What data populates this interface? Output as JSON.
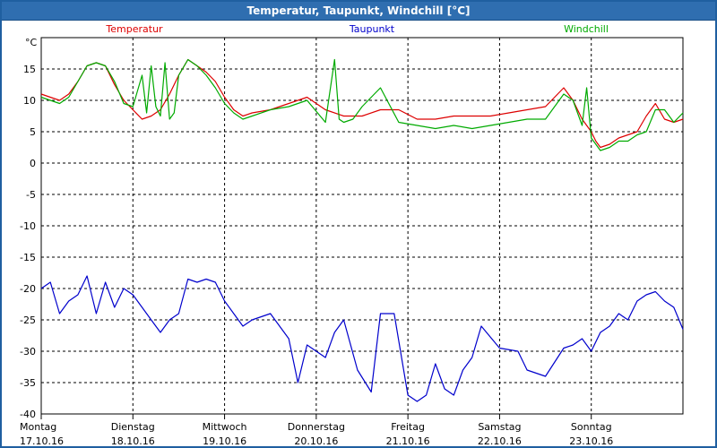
{
  "window": {
    "title": "Temperatur, Taupunkt, Windchill [°C]"
  },
  "chart_data": {
    "type": "line",
    "title": "Temperatur, Taupunkt, Windchill [°C]",
    "ylabel": "°C",
    "ylim": [
      -40,
      20
    ],
    "y_ticks": [
      15,
      10,
      5,
      0,
      -5,
      -10,
      -15,
      -20,
      -25,
      -30,
      -35,
      -40
    ],
    "xlim": [
      0,
      7
    ],
    "x_ticks": [
      {
        "day": "Montag",
        "date": "17.10.16"
      },
      {
        "day": "Dienstag",
        "date": "18.10.16"
      },
      {
        "day": "Mittwoch",
        "date": "19.10.16"
      },
      {
        "day": "Donnerstag",
        "date": "20.10.16"
      },
      {
        "day": "Freitag",
        "date": "21.10.16"
      },
      {
        "day": "Samstag",
        "date": "22.10.16"
      },
      {
        "day": "Sonntag",
        "date": "23.10.16"
      }
    ],
    "grid": true,
    "legend": "top",
    "series": [
      {
        "name": "Temperatur",
        "color": "#dd0000",
        "x": [
          0,
          0.1,
          0.2,
          0.3,
          0.4,
          0.5,
          0.6,
          0.7,
          0.8,
          0.9,
          1.0,
          1.1,
          1.2,
          1.3,
          1.4,
          1.5,
          1.6,
          1.7,
          1.8,
          1.9,
          2.0,
          2.1,
          2.2,
          2.3,
          2.5,
          2.7,
          2.9,
          3.1,
          3.3,
          3.5,
          3.7,
          3.9,
          4.1,
          4.3,
          4.5,
          4.7,
          4.9,
          5.1,
          5.3,
          5.5,
          5.7,
          5.8,
          5.9,
          6.0,
          6.05,
          6.1,
          6.2,
          6.3,
          6.4,
          6.5,
          6.6,
          6.7,
          6.8,
          6.9,
          7.0
        ],
        "values": [
          11,
          10.5,
          10,
          11,
          13,
          15.5,
          16,
          15.5,
          12.5,
          10,
          8.5,
          7,
          7.5,
          8.5,
          11,
          14,
          16.5,
          15.5,
          14.5,
          13,
          10.5,
          8.5,
          7.5,
          8,
          8.5,
          9.5,
          10.5,
          8.5,
          7.5,
          7.5,
          8.5,
          8.5,
          7,
          7,
          7.5,
          7.5,
          7.5,
          8,
          8.5,
          9,
          12,
          10,
          7,
          5,
          3.5,
          2.5,
          3,
          4,
          4.5,
          5,
          7.5,
          9.5,
          7,
          6.5,
          7
        ]
      },
      {
        "name": "Taupunkt",
        "color": "#0000cc",
        "x": [
          0,
          0.1,
          0.2,
          0.3,
          0.4,
          0.5,
          0.6,
          0.7,
          0.8,
          0.9,
          1.0,
          1.1,
          1.2,
          1.3,
          1.4,
          1.5,
          1.6,
          1.7,
          1.8,
          1.9,
          2.0,
          2.1,
          2.2,
          2.3,
          2.5,
          2.7,
          2.8,
          2.9,
          3.1,
          3.2,
          3.3,
          3.45,
          3.6,
          3.7,
          3.85,
          4.0,
          4.1,
          4.2,
          4.3,
          4.4,
          4.5,
          4.6,
          4.7,
          4.8,
          5.0,
          5.2,
          5.3,
          5.5,
          5.7,
          5.8,
          5.9,
          6.0,
          6.1,
          6.2,
          6.3,
          6.4,
          6.5,
          6.6,
          6.7,
          6.8,
          6.9,
          7.0
        ],
        "values": [
          -20,
          -19,
          -24,
          -22,
          -21,
          -18,
          -24,
          -19,
          -23,
          -20,
          -21,
          -23,
          -25,
          -27,
          -25,
          -24,
          -18.5,
          -19,
          -18.5,
          -19,
          -22,
          -24,
          -26,
          -25,
          -24,
          -28,
          -35,
          -29,
          -31,
          -27,
          -25,
          -33,
          -36.5,
          -24,
          -24,
          -37,
          -38,
          -37,
          -32,
          -36,
          -37,
          -33,
          -31,
          -26,
          -29.5,
          -30,
          -33,
          -34,
          -29.5,
          -29,
          -28,
          -30,
          -27,
          -26,
          -24,
          -25,
          -22,
          -21,
          -20.5,
          -22,
          -23,
          -26.5
        ]
      },
      {
        "name": "Windchill",
        "color": "#00aa00",
        "x": [
          0,
          0.1,
          0.2,
          0.3,
          0.4,
          0.5,
          0.6,
          0.7,
          0.8,
          0.9,
          1.0,
          1.1,
          1.15,
          1.2,
          1.25,
          1.3,
          1.35,
          1.4,
          1.45,
          1.5,
          1.6,
          1.7,
          1.8,
          1.9,
          2.0,
          2.1,
          2.2,
          2.3,
          2.5,
          2.7,
          2.9,
          3.1,
          3.2,
          3.25,
          3.3,
          3.4,
          3.5,
          3.7,
          3.9,
          4.1,
          4.3,
          4.5,
          4.7,
          4.9,
          5.1,
          5.3,
          5.5,
          5.7,
          5.8,
          5.9,
          5.95,
          6.0,
          6.1,
          6.2,
          6.3,
          6.4,
          6.5,
          6.6,
          6.7,
          6.8,
          6.9,
          7.0
        ],
        "values": [
          10.5,
          10,
          9.5,
          10.5,
          13,
          15.5,
          16,
          15.5,
          13,
          9.5,
          9,
          14,
          8,
          15.5,
          9,
          7.5,
          16,
          7,
          8,
          14,
          16.5,
          15.5,
          14,
          12,
          9.5,
          8,
          7,
          7.5,
          8.5,
          9,
          10,
          6.5,
          16.5,
          7,
          6.5,
          7,
          9,
          12,
          6.5,
          6,
          5.5,
          6,
          5.5,
          6,
          6.5,
          7,
          7,
          11,
          10,
          6,
          12,
          4,
          2,
          2.5,
          3.5,
          3.5,
          4.5,
          5,
          8.5,
          8.5,
          6.5,
          8
        ]
      }
    ]
  }
}
